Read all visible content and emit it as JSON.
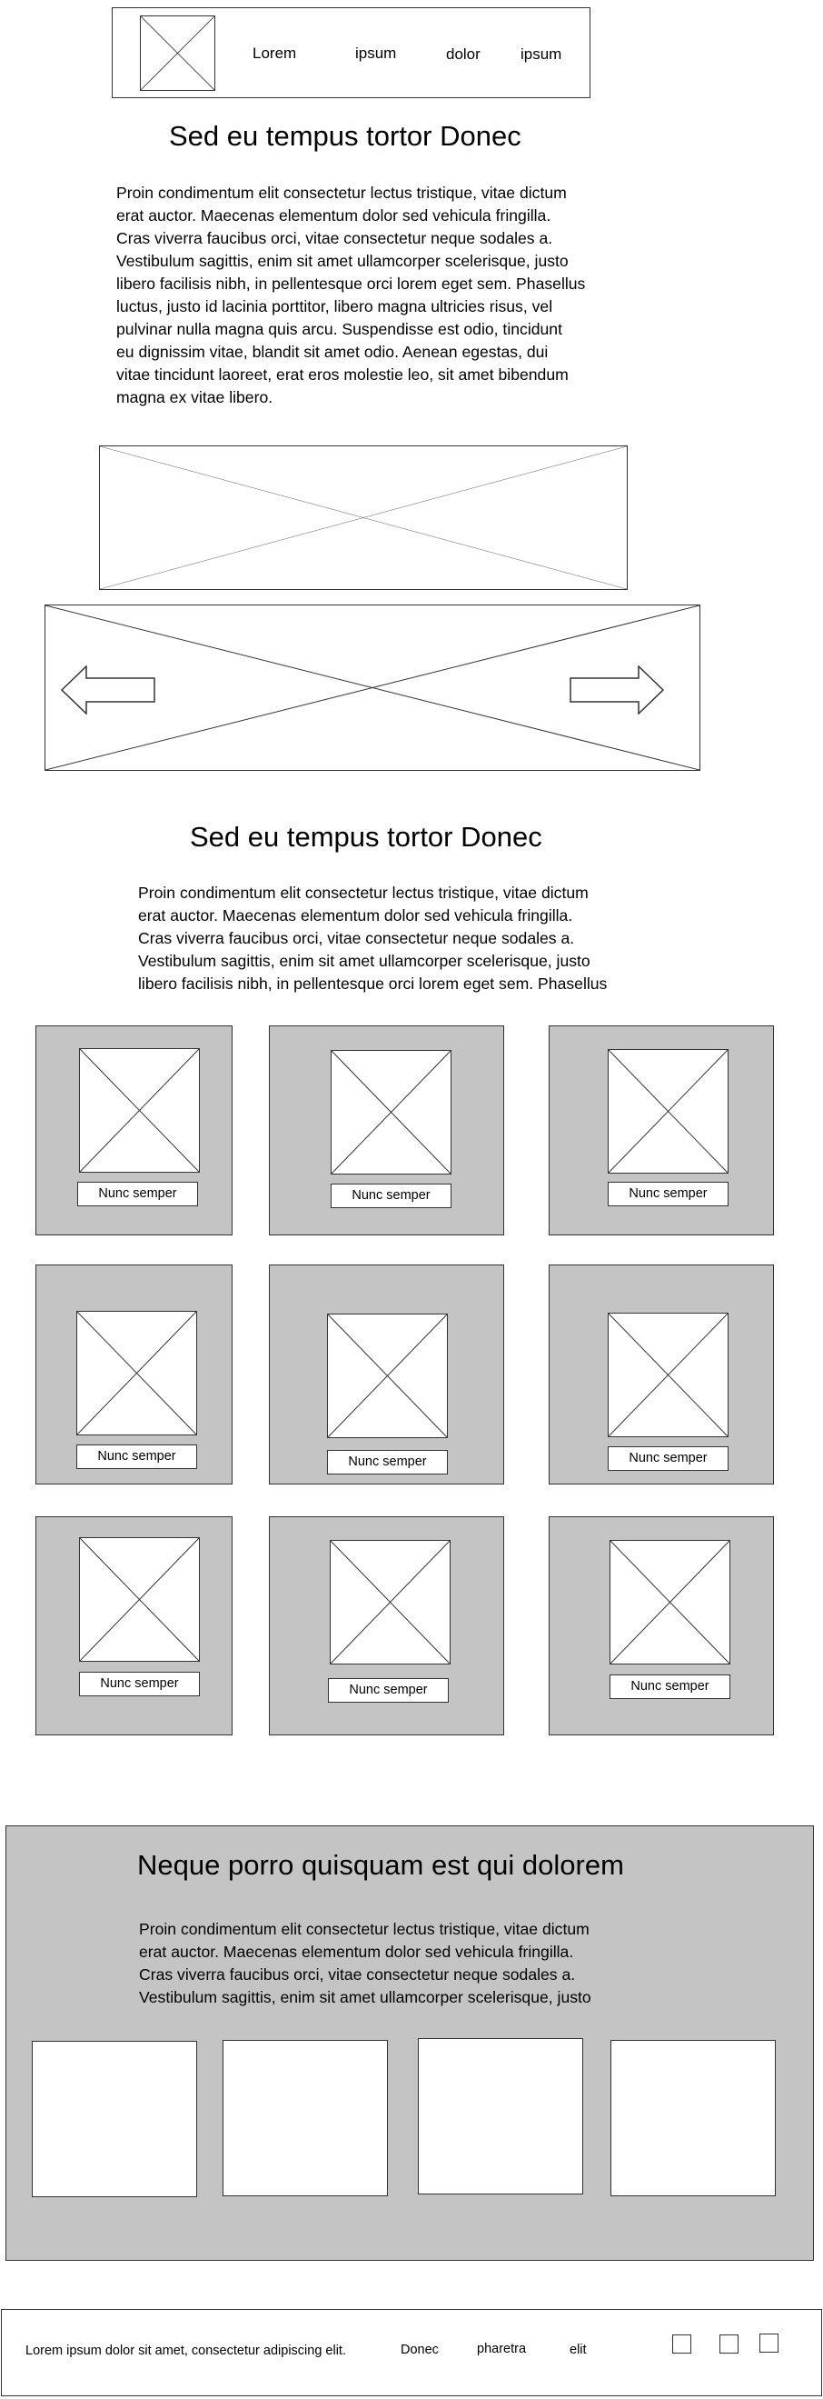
{
  "header": {
    "nav": [
      "Lorem",
      "ipsum",
      "dolor",
      "ipsum"
    ]
  },
  "section1": {
    "title": "Sed eu tempus tortor  Donec",
    "text": "Proin condimentum elit consectetur lectus tristique, vitae dictum\nerat auctor. Maecenas elementum dolor sed vehicula fringilla.\nCras viverra faucibus orci, vitae consectetur neque sodales a.\nVestibulum sagittis, enim sit amet ullamcorper scelerisque, justo\nlibero facilisis nibh, in pellentesque orci lorem eget sem. Phasellus\nluctus, justo id lacinia porttitor, libero magna ultricies risus, vel\npulvinar nulla magna quis arcu. Suspendisse est odio, tincidunt\neu dignissim vitae, blandit sit amet odio. Aenean egestas, dui\nvitae tincidunt laoreet, erat eros molestie leo, sit amet bibendum\nmagna ex vitae libero."
  },
  "carousel": {
    "prev_icon": "arrow-left-icon",
    "next_icon": "arrow-right-icon"
  },
  "section2": {
    "title": "Sed eu tempus tortor  Donec",
    "text": "Proin condimentum elit consectetur lectus tristique, vitae dictum\nerat auctor. Maecenas elementum dolor sed vehicula fringilla.\nCras viverra faucibus orci, vitae consectetur neque sodales a.\nVestibulum sagittis, enim sit amet ullamcorper scelerisque, justo\nlibero facilisis nibh, in pellentesque orci lorem eget sem. Phasellus"
  },
  "grid": {
    "cards": [
      {
        "label": "Nunc semper"
      },
      {
        "label": "Nunc semper"
      },
      {
        "label": "Nunc semper"
      },
      {
        "label": "Nunc semper"
      },
      {
        "label": "Nunc semper"
      },
      {
        "label": "Nunc semper"
      },
      {
        "label": "Nunc semper"
      },
      {
        "label": "Nunc semper"
      },
      {
        "label": "Nunc semper"
      }
    ]
  },
  "feature": {
    "title": "Neque porro quisquam est qui dolorem",
    "text": "Proin condimentum elit consectetur lectus tristique, vitae dictum\nerat auctor. Maecenas elementum dolor sed vehicula fringilla.\nCras viverra faucibus orci, vitae consectetur neque sodales a.\nVestibulum sagittis, enim sit amet ullamcorper scelerisque, justo"
  },
  "footer": {
    "text": "Lorem ipsum dolor sit amet, consectetur adipiscing elit.",
    "links": [
      "Donec",
      "pharetra",
      "elit"
    ]
  },
  "colors": {
    "card_bg": "#c4c4c4",
    "border": "#333333"
  }
}
